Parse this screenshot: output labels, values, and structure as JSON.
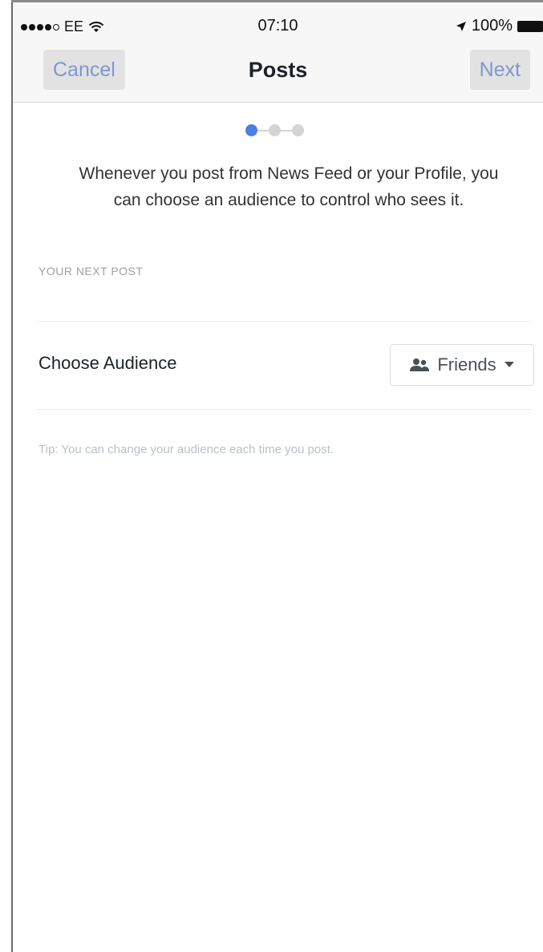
{
  "status_bar": {
    "carrier": "EE",
    "time": "07:10",
    "battery": "100%"
  },
  "nav": {
    "cancel_label": "Cancel",
    "title": "Posts",
    "next_label": "Next"
  },
  "stepper": {
    "current_step": 1,
    "total_steps": 3
  },
  "intro_text": "Whenever you post from News Feed or your Profile, you can choose an audience to control who sees it.",
  "section": {
    "header": "YOUR NEXT POST",
    "row_label": "Choose Audience",
    "audience_value": "Friends"
  },
  "tip": "Tip: You can change your audience each time you post.",
  "colors": {
    "accent": "#4b7fe0",
    "nav_button_text": "#7f97cf",
    "tip_text": "#b7c0cc"
  }
}
